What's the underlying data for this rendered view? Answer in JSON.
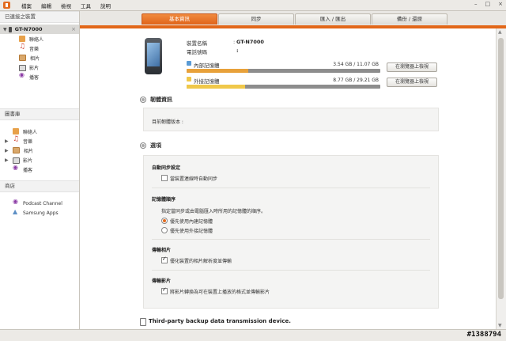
{
  "menu": {
    "items": [
      "檔案",
      "編輯",
      "檢視",
      "工具",
      "說明"
    ]
  },
  "window_controls": [
    "–",
    "□",
    "×"
  ],
  "sidebar": {
    "connected_header": "已連接之裝置",
    "device_name": "GT-N7000",
    "device_items": [
      "聯絡人",
      "音樂",
      "相片",
      "影片",
      "播客"
    ],
    "library_header": "圖書庫",
    "library_items": [
      "聯絡人",
      "音樂",
      "相片",
      "影片",
      "播客"
    ],
    "store_header": "商店",
    "store_items": [
      "Podcast Channel",
      "Samsung Apps"
    ]
  },
  "tabs": [
    "基本資訊",
    "同步",
    "匯入 / 匯出",
    "備份 / 還原"
  ],
  "device_info": {
    "name_label": "裝置名稱",
    "name_value": "GT-N7000",
    "phone_label": "電話號碼",
    "phone_value": "",
    "internal_label": "內部記憶體",
    "internal_size": "3.54 GB / 11.07 GB",
    "internal_used": 0.32,
    "external_label": "外接記憶體",
    "external_size": "8.77 GB / 29.21 GB",
    "external_used": 0.3,
    "browse_button": "在瀏覽器上檢視"
  },
  "firmware": {
    "title": "韌體資訊",
    "current_label": "目前韌體版本 :"
  },
  "options": {
    "title": "選項",
    "autosync_header": "自動同步設定",
    "autosync_check": "當裝置連線時自動同步",
    "memory_header": "記憶體順序",
    "memory_desc": "指定當同步或由電腦匯入時所用的記憶體的順序。",
    "memory_opt1": "優先使用內建記憶體",
    "memory_opt2": "優先使用外接記憶體",
    "photo_header": "傳輸相片",
    "photo_check": "優化裝置的相片解析度並傳輸",
    "video_header": "傳輸影片",
    "video_check": "將影片轉換為可在裝置上播放的格式並傳輸影片"
  },
  "backup": {
    "text": "Third-party backup data transmission device."
  },
  "watermark": "#1388794",
  "colors": {
    "accent": "#e26719",
    "internal_fill": "#e8a13a",
    "external_fill": "#f0c84a"
  }
}
